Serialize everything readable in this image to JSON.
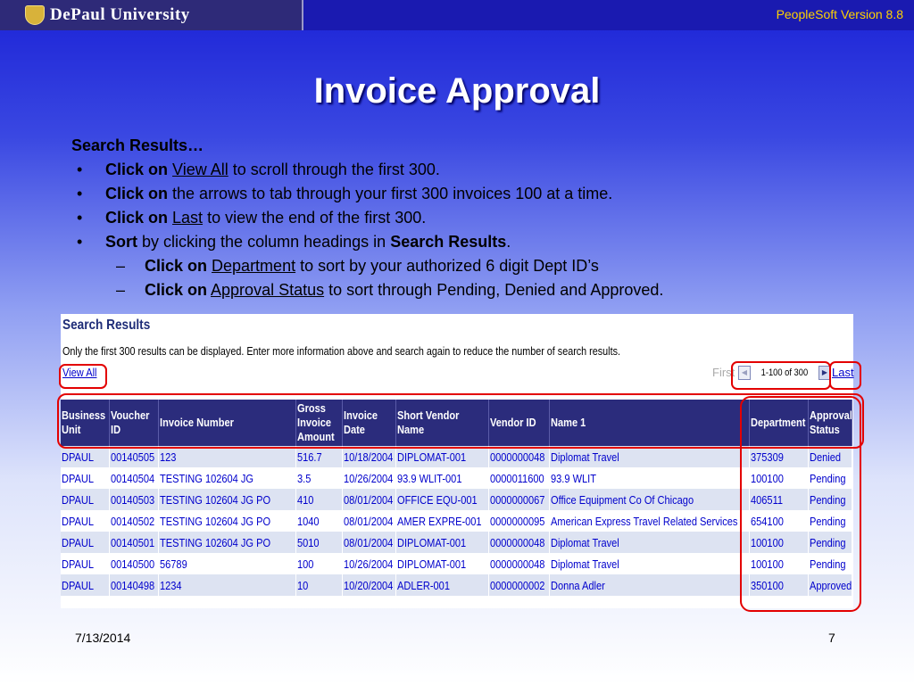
{
  "header": {
    "logo": "DePaul University",
    "version": "PeopleSoft Version 8.8"
  },
  "title": "Invoice Approval",
  "bullets": {
    "heading": "Search Results…",
    "marker_bullet": "•",
    "marker_dash": "–",
    "b1": {
      "bold": "Click on",
      "link": "View All",
      "rest": "to scroll through the first 300."
    },
    "b2": {
      "bold": "Click on",
      "rest": "the arrows to tab through your first 300 invoices 100 at a time."
    },
    "b3": {
      "bold": "Click on",
      "link": "Last",
      "rest": "to view the end of the first 300."
    },
    "b4": {
      "bold": "Sort",
      "rest": "by clicking the column headings in",
      "bold2": "Search Results",
      "end": "."
    },
    "s1": {
      "bold": "Click on",
      "link": "Department",
      "rest": "to sort by your authorized 6 digit Dept ID’s"
    },
    "s2": {
      "bold": "Click on",
      "link": "Approval Status",
      "rest": "to sort through Pending, Denied and Approved."
    }
  },
  "screen": {
    "title": "Search Results",
    "note": "Only the first 300 results can be displayed. Enter more information above and search again to reduce the number of search results.",
    "view_all": "View All",
    "first": "First",
    "prev_arrow": "◀",
    "next_arrow": "▶",
    "page_count": "1-100 of 300",
    "last": "Last",
    "columns": [
      "Business Unit",
      "Voucher ID",
      "Invoice Number",
      "Gross Invoice Amount",
      "Invoice Date",
      "Short Vendor Name",
      "Vendor ID",
      "Name 1",
      "Department",
      "Approval Status"
    ],
    "rows": [
      [
        "DPAUL",
        "00140505",
        "123",
        "516.7",
        "10/18/2004",
        "DIPLOMAT-001",
        "0000000048",
        "Diplomat Travel",
        "375309",
        "Denied"
      ],
      [
        "DPAUL",
        "00140504",
        "TESTING 102604 JG",
        "3.5",
        "10/26/2004",
        "93.9 WLIT-001",
        "0000011600",
        "93.9 WLIT",
        "100100",
        "Pending"
      ],
      [
        "DPAUL",
        "00140503",
        "TESTING 102604 JG PO",
        "410",
        "08/01/2004",
        "OFFICE EQU-001",
        "0000000067",
        "Office Equipment Co Of Chicago",
        "406511",
        "Pending"
      ],
      [
        "DPAUL",
        "00140502",
        "TESTING 102604 JG PO",
        "1040",
        "08/01/2004",
        "AMER EXPRE-001",
        "0000000095",
        "American Express Travel Related Services",
        "654100",
        "Pending"
      ],
      [
        "DPAUL",
        "00140501",
        "TESTING 102604 JG PO",
        "5010",
        "08/01/2004",
        "DIPLOMAT-001",
        "0000000048",
        "Diplomat Travel",
        "100100",
        "Pending"
      ],
      [
        "DPAUL",
        "00140500",
        "56789",
        "100",
        "10/26/2004",
        "DIPLOMAT-001",
        "0000000048",
        "Diplomat Travel",
        "100100",
        "Pending"
      ],
      [
        "DPAUL",
        "00140498",
        "1234",
        "10",
        "10/20/2004",
        "ADLER-001",
        "0000000002",
        "Donna Adler",
        "350100",
        "Approved"
      ]
    ]
  },
  "footer": {
    "date": "7/13/2014",
    "page": "7"
  },
  "colors": {
    "title_bar": "#1a1ab0",
    "grid_header": "#2b2c7c",
    "highlight": "#e30000",
    "link": "#0000cc"
  }
}
